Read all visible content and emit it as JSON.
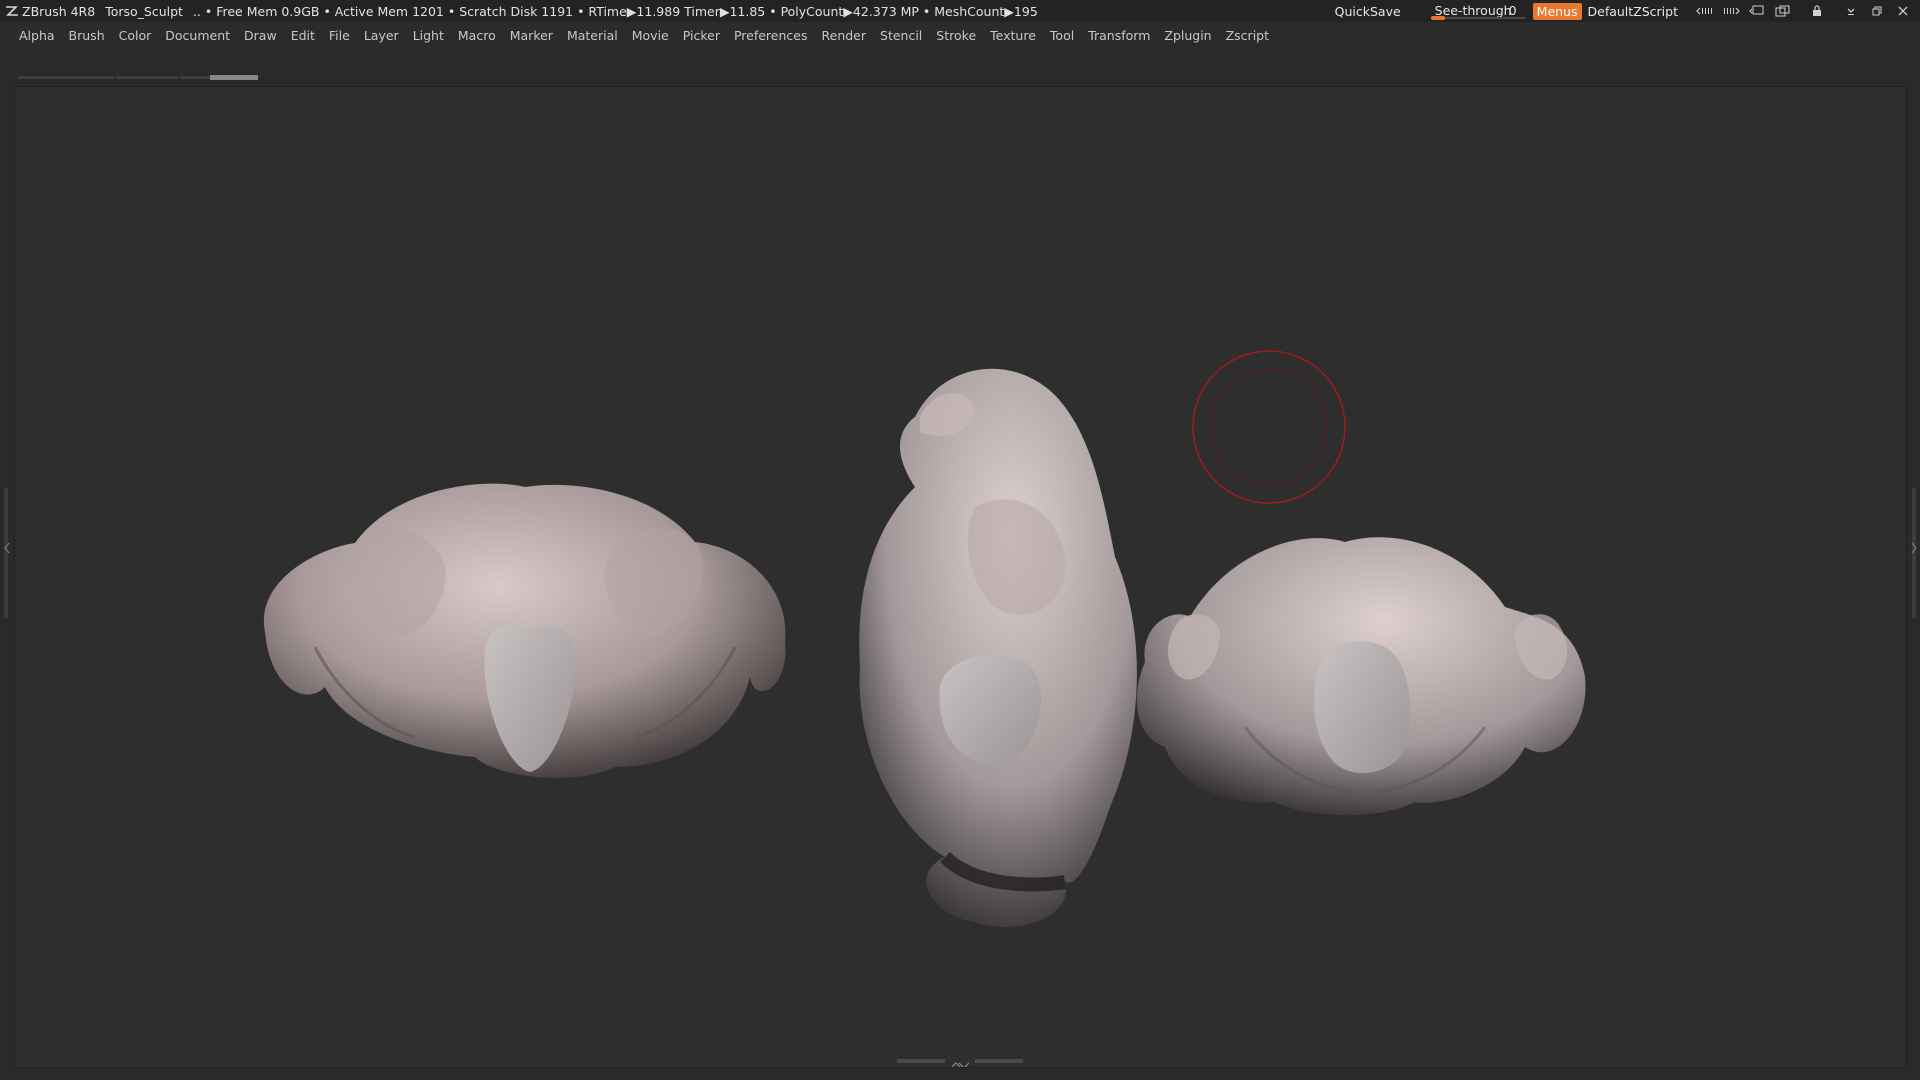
{
  "titlebar": {
    "app_name": "ZBrush 4R8",
    "document": "Torso_Sculpt",
    "status": ".. • Free Mem 0.9GB • Active Mem 1201 • Scratch Disk 1191 •  RTime▶11.989 Timer▶11.85 • PolyCount▶42.373 MP  • MeshCount▶195",
    "quicksave": "QuickSave",
    "seethrough_label": "See-through",
    "seethrough_value": "0",
    "seethrough_level": 0.0,
    "menus_label": "Menus",
    "zscript_name": "DefaultZScript",
    "accent_color": "#e8782c",
    "icons": [
      "layout-left-icon",
      "layout-right-icon",
      "floating-window-icon",
      "window-copy-icon",
      "lock-icon",
      "minimize-icon",
      "restore-icon",
      "close-icon"
    ]
  },
  "menubar": {
    "items": [
      "Alpha",
      "Brush",
      "Color",
      "Document",
      "Draw",
      "Edit",
      "File",
      "Layer",
      "Light",
      "Macro",
      "Marker",
      "Material",
      "Movie",
      "Picker",
      "Preferences",
      "Render",
      "Stencil",
      "Stroke",
      "Texture",
      "Tool",
      "Transform",
      "Zplugin",
      "Zscript"
    ]
  },
  "canvas": {
    "background": "#2e2e2e",
    "brush_cursor_color": "#b02020",
    "clay_color": "#b8a8a6"
  }
}
